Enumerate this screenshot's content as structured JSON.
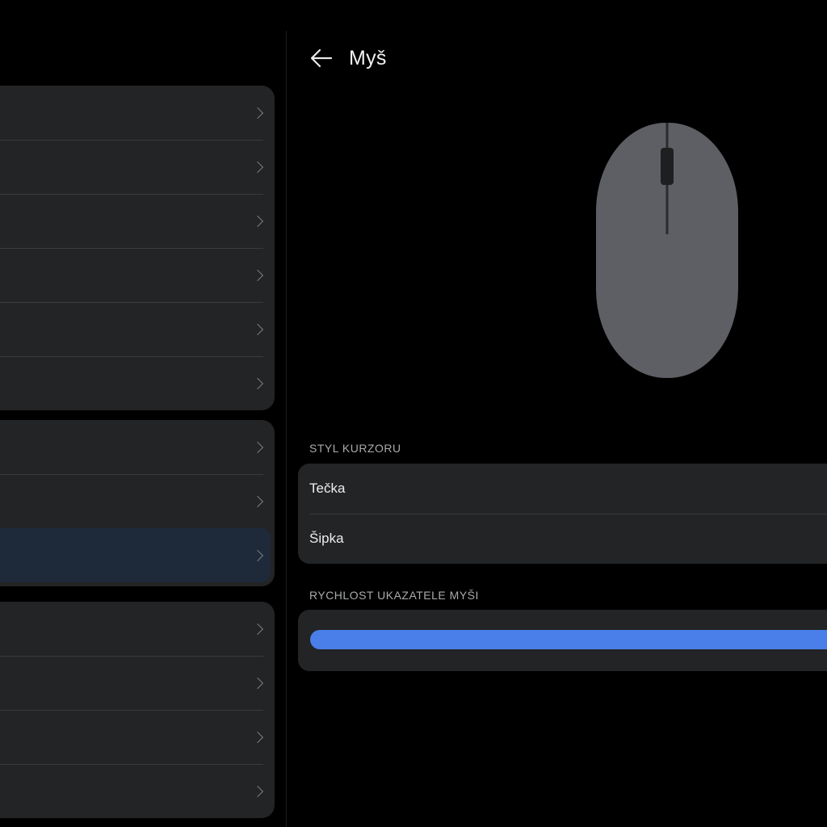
{
  "header": {
    "title": "Myš"
  },
  "cursor_style": {
    "section_label": "STYL KURZORU",
    "options": [
      {
        "label": "Tečka"
      },
      {
        "label": "Šipka"
      }
    ]
  },
  "pointer_speed": {
    "section_label": "RYCHLOST UKAZATELE MYŠI",
    "value_fraction": 1.0
  },
  "left_menu": {
    "group_sizes": [
      6,
      3,
      4
    ],
    "selected_group": 1,
    "selected_index": 2
  },
  "colors": {
    "background": "#000000",
    "card": "#232426",
    "accent": "#4a7ee8",
    "selected_row": "#1e2a3a",
    "mouse_body": "#5d5f64"
  },
  "icons": {
    "back": "arrow-left-icon",
    "row_chevron": "chevron-right-icon"
  }
}
